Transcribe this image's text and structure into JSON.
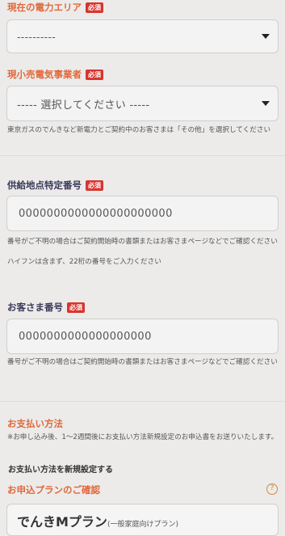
{
  "area": {
    "label": "現在の電力エリア",
    "required": "必須",
    "value": "----------"
  },
  "retailer": {
    "label": "現小売電気事業者",
    "required": "必須",
    "value": "----- 選択してください -----",
    "note": "東京ガスのでんきなど新電力とご契約中のお客さまは「その他」を選択してください"
  },
  "supply_point": {
    "label": "供給地点特定番号",
    "required": "必須",
    "value": "0000000000000000000000",
    "note1": "番号がご不明の場合はご契約開始時の書類またはお客さまページなどでご確認ください",
    "note2": "ハイフンは含まず、22桁の番号をご入力ください"
  },
  "customer_no": {
    "label": "お客さま番号",
    "required": "必須",
    "value": "0000000000000000000",
    "note": "番号がご不明の場合はご契約開始時の書類またはお客さまページなどでご確認ください"
  },
  "payment": {
    "label": "お支払い方法",
    "note": "※お申し込み後、1〜2週間後にお支払い方法新規設定のお申込書をお送りいたします。",
    "new_setting": "お支払い方法を新規設定する"
  },
  "plan": {
    "label": "お申込プランのご確認",
    "help": "?",
    "title": "でんきMプラン",
    "subtitle": "(一般家庭向けプラン)"
  },
  "colors": {
    "accent": "#e0683a",
    "required_badge": "#d8342e",
    "background": "#ecebea"
  }
}
